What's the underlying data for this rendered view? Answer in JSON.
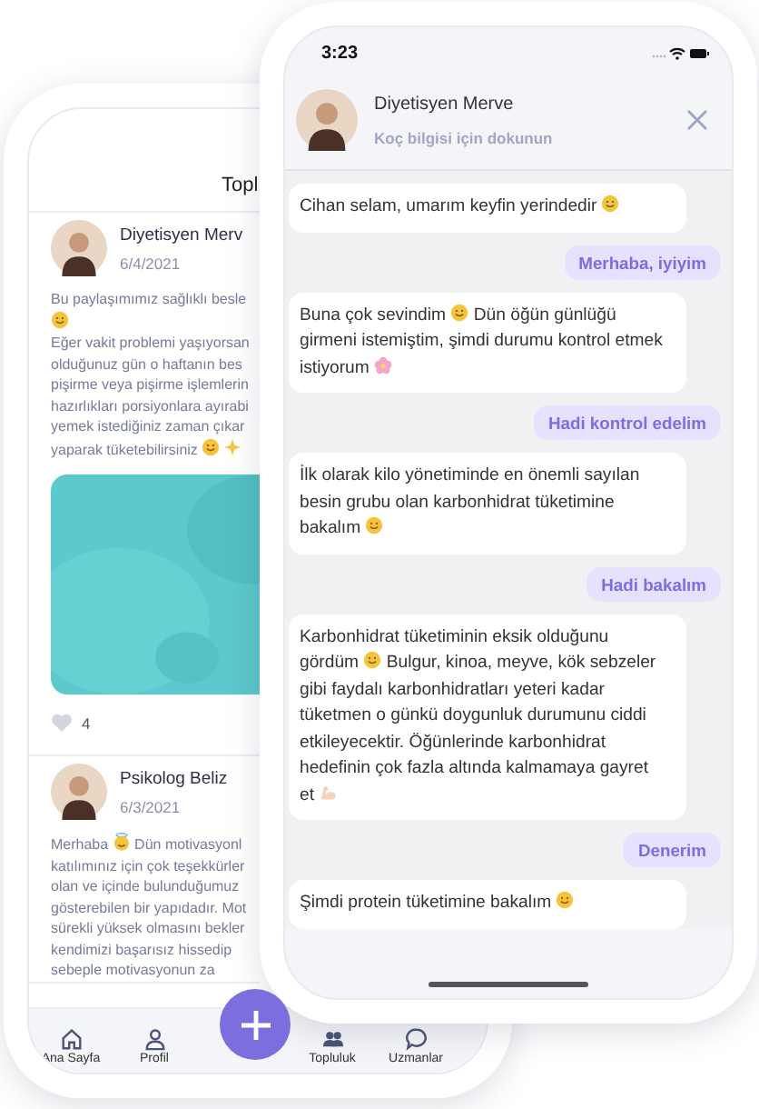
{
  "back_phone": {
    "title": "Topl",
    "posts": [
      {
        "author": "Diyetisyen Merv",
        "date": "6/4/2021",
        "media": {
          "kind": "picture"
        },
        "likes": "4",
        "lines": [
          [
            {
              "kind": "text",
              "text": "Bu paylaşımımız sağlıklı besle"
            }
          ],
          [
            {
              "kind": "smiley"
            }
          ],
          [
            {
              "kind": "text",
              "text": "Eğer vakit problemi yaşıyorsan"
            }
          ],
          [
            {
              "kind": "text",
              "text": "olduğunuz gün o haftanın bes"
            }
          ],
          [
            {
              "kind": "text",
              "text": "pişirme veya pişirme işlemlerin"
            }
          ],
          [
            {
              "kind": "text",
              "text": "hazırlıkları porsiyonlara ayırabi"
            }
          ],
          [
            {
              "kind": "text",
              "text": "yemek istediğiniz zaman çıkar"
            }
          ],
          [
            {
              "kind": "text",
              "text": "yaparak tüketebilirsiniz"
            },
            {
              "kind": "smiley"
            },
            {
              "kind": "sparkle"
            }
          ]
        ]
      },
      {
        "author": "Psikolog Beliz",
        "date": "6/3/2021",
        "lines": [
          [
            {
              "kind": "text",
              "text": "Merhaba"
            },
            {
              "kind": "angel"
            },
            {
              "kind": "text",
              "text": "Dün motivasyonl"
            }
          ],
          [
            {
              "kind": "text",
              "text": "katılımınız için çok teşekkürler"
            }
          ],
          [
            {
              "kind": "text",
              "text": "olan ve içinde bulunduğumuz"
            }
          ],
          [
            {
              "kind": "text",
              "text": "gösterebilen bir yapıdadır. Mot"
            }
          ],
          [
            {
              "kind": "text",
              "text": "sürekli yüksek olmasını bekler"
            }
          ],
          [
            {
              "kind": "text",
              "text": "kendimizi başarısız hissedip"
            }
          ],
          [
            {
              "kind": "text",
              "text": "sebeple motivasyonun za"
            }
          ]
        ]
      }
    ],
    "tab_bar": [
      {
        "label": "Ana Sayfa"
      },
      {
        "label": "Profil"
      },
      {
        "label": "Topluluk"
      },
      {
        "label": "Uzmanlar"
      }
    ]
  },
  "front_phone": {
    "time": "3:23",
    "header": {
      "name": "Diyetisyen Merve",
      "subtitle": "Koç bilgisi için dokunun"
    },
    "messages": [
      {
        "kind": "incoming",
        "parts": [
          {
            "kind": "text",
            "text": "Cihan selam, umarım keyfin yerindedir"
          },
          {
            "kind": "smiley"
          }
        ]
      },
      {
        "kind": "outgoing",
        "parts": [
          {
            "kind": "text",
            "text": "Merhaba, iyiyim"
          }
        ]
      },
      {
        "kind": "incoming",
        "parts": [
          {
            "kind": "text",
            "text": "Buna çok sevindim"
          },
          {
            "kind": "smiley"
          },
          {
            "kind": "text",
            "text": "Dün öğün günlüğü girmeni istemiştim, şimdi durumu kontrol etmek istiyorum"
          },
          {
            "kind": "flower"
          }
        ]
      },
      {
        "kind": "outgoing",
        "parts": [
          {
            "kind": "text",
            "text": "Hadi kontrol edelim"
          }
        ]
      },
      {
        "kind": "incoming",
        "parts": [
          {
            "kind": "text",
            "text": "İlk olarak kilo yönetiminde en önemli sayılan besin grubu olan karbonhidrat tüketimine bakalım"
          },
          {
            "kind": "smiley"
          }
        ]
      },
      {
        "kind": "outgoing",
        "parts": [
          {
            "kind": "text",
            "text": "Hadi bakalım"
          }
        ]
      },
      {
        "kind": "incoming",
        "parts": [
          {
            "kind": "text",
            "text": "Karbonhidrat tüketiminin eksik olduğunu gördüm"
          },
          {
            "kind": "smiley"
          },
          {
            "kind": "text",
            "text": "Bulgur, kinoa, meyve, kök sebzeler gibi faydalı karbonhidratları yeteri kadar tüketmen o günkü doygunluk durumunu ciddi etkileyecektir. Öğünlerinde karbonhidrat hedefinin çok fazla altında kalmamaya gayret et"
          },
          {
            "kind": "muscle"
          }
        ]
      },
      {
        "kind": "outgoing",
        "parts": [
          {
            "kind": "text",
            "text": "Denerim"
          }
        ]
      },
      {
        "kind": "incoming",
        "parts": [
          {
            "kind": "text",
            "text": "Şimdi protein tüketimine bakalım"
          },
          {
            "kind": "smiley"
          }
        ]
      }
    ]
  }
}
